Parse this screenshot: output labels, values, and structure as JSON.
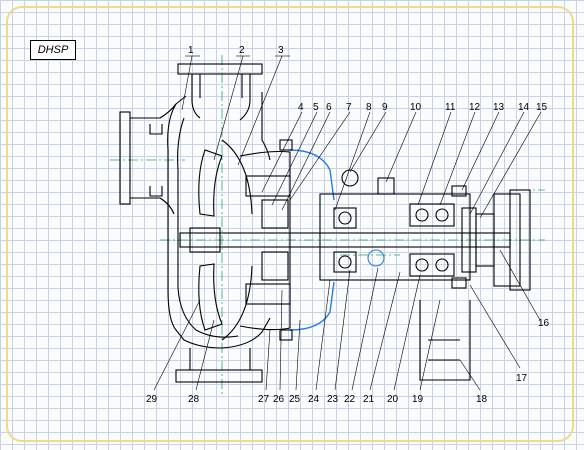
{
  "model_label": "DHSP",
  "part_numbers": [
    "1",
    "2",
    "3",
    "4",
    "5",
    "6",
    "7",
    "8",
    "9",
    "10",
    "11",
    "12",
    "13",
    "14",
    "15",
    "16",
    "17",
    "18",
    "19",
    "20",
    "21",
    "22",
    "23",
    "24",
    "25",
    "26",
    "27",
    "28",
    "29"
  ],
  "colors": {
    "frame": "#f2d98a",
    "grid": "#c9d1e6",
    "line": "#000000",
    "centerline": "#2aa76a",
    "accent": "#2a7de1"
  }
}
